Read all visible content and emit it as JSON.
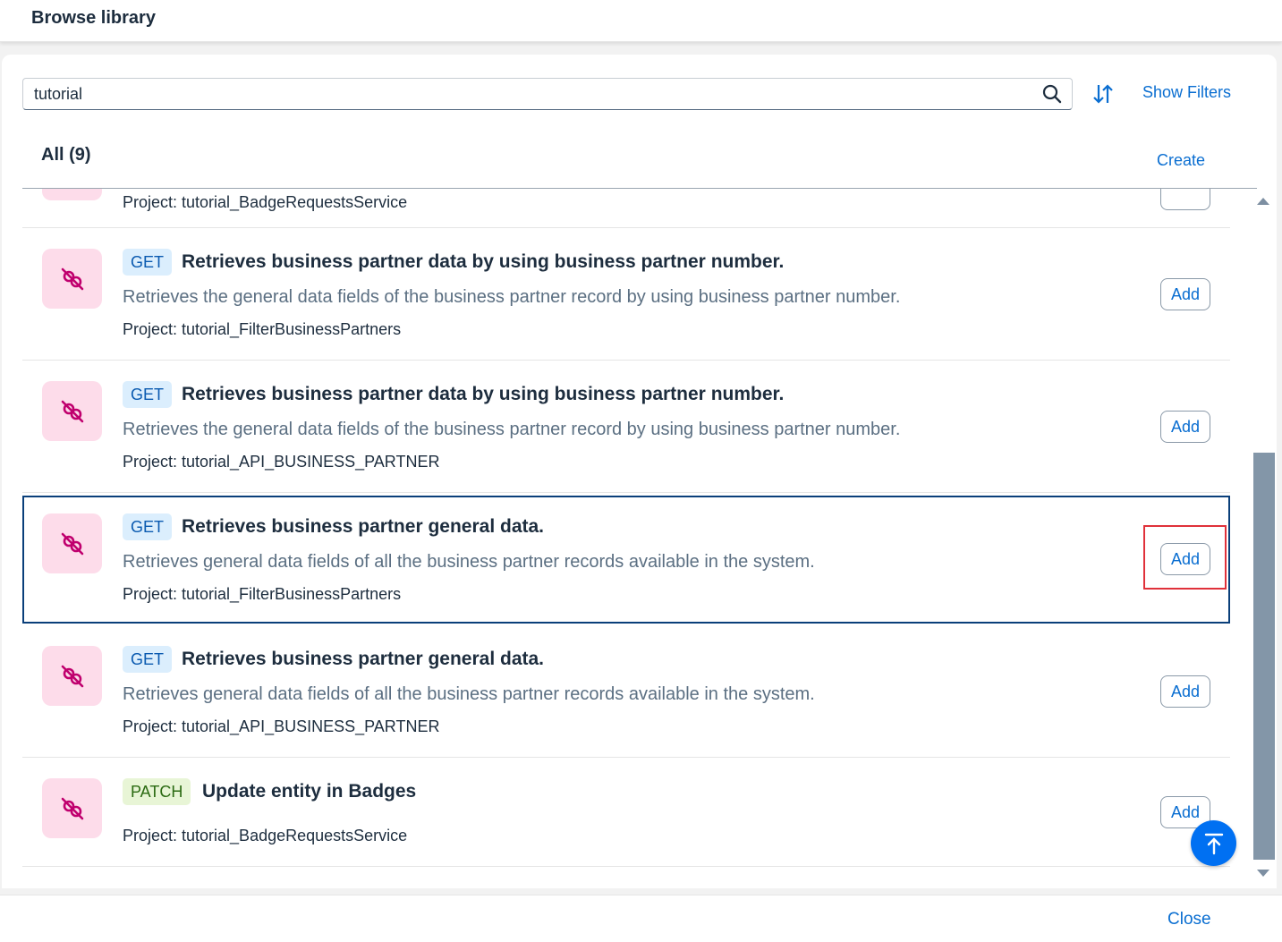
{
  "dialog": {
    "title": "Browse library",
    "close_label": "Close"
  },
  "search": {
    "value": "tutorial"
  },
  "toolbar": {
    "show_filters_label": "Show Filters",
    "create_label": "Create"
  },
  "list": {
    "title": "All (9)",
    "partial_top_row": {
      "project": "Project: tutorial_BadgeRequestsService"
    },
    "items": [
      {
        "method": "GET",
        "title": "Retrieves business partner data by using business partner number.",
        "description": "Retrieves the general data fields of the business partner record by using business partner number.",
        "project": "Project: tutorial_FilterBusinessPartners",
        "add_label": "Add"
      },
      {
        "method": "GET",
        "title": "Retrieves business partner data by using business partner number.",
        "description": "Retrieves the general data fields of the business partner record by using business partner number.",
        "project": "Project: tutorial_API_BUSINESS_PARTNER",
        "add_label": "Add"
      },
      {
        "method": "GET",
        "title": "Retrieves business partner general data.",
        "description": "Retrieves general data fields of all the business partner records available in the system.",
        "project": "Project: tutorial_FilterBusinessPartners",
        "add_label": "Add"
      },
      {
        "method": "GET",
        "title": "Retrieves business partner general data.",
        "description": "Retrieves general data fields of all the business partner records available in the system.",
        "project": "Project: tutorial_API_BUSINESS_PARTNER",
        "add_label": "Add"
      },
      {
        "method": "PATCH",
        "title": "Update entity in Badges",
        "description": "",
        "project": "Project: tutorial_BadgeRequestsService",
        "add_label": "Add"
      }
    ]
  },
  "icons": {
    "search": "search-icon",
    "sort": "sort-icon",
    "item": "api-link-icon",
    "scroll_top": "arrow-up-to-top-icon"
  },
  "colors": {
    "accent": "#0a6ed1",
    "avatar_bg": "#fddcea",
    "avatar_icon": "#c0006e",
    "selection": "#0a3f7a",
    "highlight": "#e0313a"
  }
}
